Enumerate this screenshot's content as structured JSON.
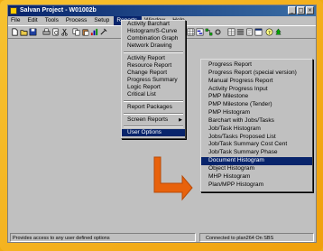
{
  "window": {
    "title": "Salvan Project - W01002b",
    "controls": [
      "_",
      "□",
      "×"
    ]
  },
  "menubar": {
    "items": [
      "File",
      "Edit",
      "Tools",
      "Process",
      "Setup",
      "Reports",
      "Window",
      "Help"
    ],
    "active": "Reports"
  },
  "reports_menu": {
    "items": [
      "Activity Barchart",
      "Histogram/S-Curve",
      "Combination Graph",
      "Network Drawing",
      "Activity Report",
      "Resource Report",
      "Change Report",
      "Progress Summary",
      "Logic Report",
      "Critical List",
      "Report Packages",
      "Screen Reports",
      "User Options"
    ],
    "selected": "User Options"
  },
  "screen_reports_menu": {
    "items": [
      "Progress Report",
      "Progress Report (special version)",
      "Manual Progress Report",
      "Activity Progress Input",
      "PMP Milestone",
      "PMP Milestone (Tender)",
      "PMP Histogram",
      "Barchart with Jobs/Tasks",
      "Job/Task Histogram",
      "Jobs/Tasks Proposed List",
      "Job/Task Summary Cost Cent",
      "Job/Task Summary Phase",
      "Document Histogram",
      "Object Histogram",
      "MHP Histogram",
      "Plan/MPP Histogram"
    ],
    "selected": "Document Histogram"
  },
  "statusbar": {
    "left": "Provides access to any user defined options",
    "right": "Connected to plan264 On SBS"
  },
  "colors": {
    "frame": "#f0ac10",
    "arrow": "#e8620c",
    "selection": "#08246b"
  }
}
